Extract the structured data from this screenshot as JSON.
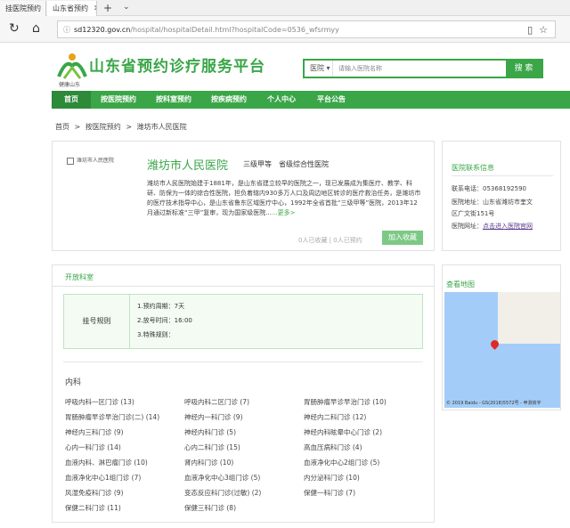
{
  "browser": {
    "tabs": [
      {
        "label": "挂医院预约"
      },
      {
        "label": "山东省预约"
      }
    ],
    "new_tab": "+",
    "tab_menu": "⌄",
    "address_domain": "sd12320.gov.cn",
    "address_path": "/hospital/hospitalDetail.html?hospitalCode=0536_wfsrmyy"
  },
  "site": {
    "logo_caption": "健康山东",
    "title": "山东省预约诊疗服务平台",
    "search": {
      "select": "医院",
      "placeholder": "请输入医院名称",
      "button": "搜 索"
    },
    "nav": [
      "首页",
      "按医院预约",
      "按科室预约",
      "按疾病预约",
      "个人中心",
      "平台公告"
    ]
  },
  "breadcrumb": [
    "首页",
    ">",
    "按医院预约",
    ">",
    "潍坊市人民医院"
  ],
  "hospital": {
    "thumb_label": "潍坊市人民医院",
    "name": "潍坊市人民医院",
    "level": "三级甲等",
    "type": "省级综合性医院",
    "desc": "潍坊市人民医院始建于1881年，是山东省建立较早的医院之一，现已发展成为集医疗、教学、科研、防保为一体的综合性医院，担负着辖内930多万人口及周边地区转诊的医疗救治任务，是潍坊市的医疗技术指导中心，是山东省鲁东区域医疗中心，1992年全省首批“三级甲等”医院，2013年12月通过新标准“三甲”复审，现为国家级医院...",
    "more": "...更多>",
    "stats": "0人已收藏 | 0人已预约",
    "follow": "加入收藏"
  },
  "contact": {
    "title": "医院联系信息",
    "phone": "联系电话：05368192590",
    "address1": "医院地址：山东省潍坊市奎文",
    "address2": "区广文街151号",
    "website_label": "医院网址：",
    "website_link": "点击进入医院官网"
  },
  "departments": {
    "title": "开放科室",
    "rules_label": "挂号规则",
    "rules": [
      "1.预约周期：7天",
      "2.放号时间：16:00",
      "3.特殊规则："
    ],
    "category": "内科",
    "items": [
      [
        "呼吸内科一区门诊 (13)",
        "呼吸内科二区门诊 (7)",
        "胃肠肿瘤早诊早治门诊 (10)"
      ],
      [
        "胃肠肿瘤早诊早治门诊(二) (14)",
        "神经内一科门诊 (9)",
        "神经内二科门诊 (12)"
      ],
      [
        "神经内三科门诊 (9)",
        "神经内科门诊 (5)",
        "神经内科眩晕中心门诊 (2)"
      ],
      [
        "心内一科门诊 (14)",
        "心内二科门诊 (15)",
        "高血压病科门诊 (4)"
      ],
      [
        "血液内科、淋巴瘤门诊 (10)",
        "肾内科门诊 (10)",
        "血液净化中心2组门诊 (5)"
      ],
      [
        "血液净化中心1组门诊 (7)",
        "血液净化中心3组门诊 (5)",
        "内分泌科门诊 (10)"
      ],
      [
        "风湿免疫科门诊 (9)",
        "变态反应科门诊(过敏) (2)",
        "保健一科门诊 (7)"
      ],
      [
        "保健二科门诊 (11)",
        "保健三科门诊 (8)",
        ""
      ]
    ]
  },
  "map": {
    "title": "查看地图",
    "copyright": "© 2019 Baidu - GS(2018)5572号 - 甲测资字"
  }
}
